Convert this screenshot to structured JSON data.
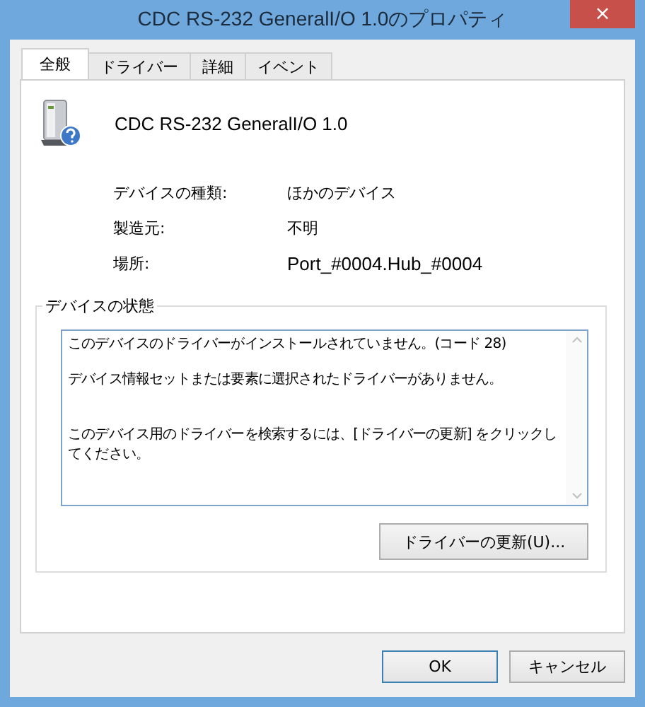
{
  "window": {
    "title": "CDC RS-232 GeneralI/O 1.0のプロパティ",
    "close": "×"
  },
  "tabs": [
    {
      "label": "全般",
      "selected": true
    },
    {
      "label": "ドライバー",
      "selected": false
    },
    {
      "label": "詳細",
      "selected": false
    },
    {
      "label": "イベント",
      "selected": false
    }
  ],
  "device": {
    "name": "CDC RS-232 GeneralI/O 1.0"
  },
  "properties": [
    {
      "label": "デバイスの種類:",
      "value": "ほかのデバイス"
    },
    {
      "label": "製造元:",
      "value": "不明"
    },
    {
      "label": "場所:",
      "value": "Port_#0004.Hub_#0004"
    }
  ],
  "status": {
    "title": "デバイスの状態",
    "paragraphs": [
      "このデバイスのドライバーがインストールされていません。(コード 28)",
      "デバイス情報セットまたは要素に選択されたドライバーがありません。",
      "このデバイス用のドライバーを検索するには、[ドライバーの更新] をクリックしてください。"
    ],
    "button": "ドライバーの更新(U)..."
  },
  "buttons": [
    {
      "label": "OK",
      "default": true
    },
    {
      "label": "キャンセル",
      "default": false
    }
  ]
}
